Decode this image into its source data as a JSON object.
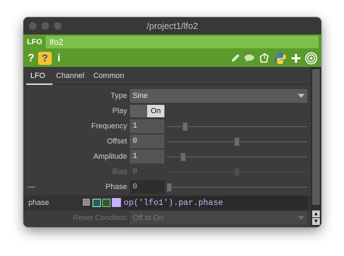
{
  "window": {
    "title": "/project1/lfo2"
  },
  "operator": {
    "type_label": "LFO",
    "name": "lfo2"
  },
  "icon_bar": {
    "help_left": "?",
    "help_python": "?",
    "info": "i",
    "icons": [
      "pencil-icon",
      "comment-icon",
      "clone-icon",
      "python-icon",
      "plus-icon",
      "viewer-icon"
    ]
  },
  "tabs": [
    "LFO",
    "Channel",
    "Common"
  ],
  "params": {
    "type": {
      "label": "Type",
      "value": "Sine"
    },
    "play": {
      "label": "Play",
      "value": "On"
    },
    "frequency": {
      "label": "Frequency",
      "value": "1"
    },
    "offset": {
      "label": "Offset",
      "value": "0"
    },
    "amplitude": {
      "label": "Amplitude",
      "value": "1"
    },
    "bias": {
      "label": "Bias",
      "value": "0"
    },
    "phase": {
      "label": "Phase",
      "value": "0",
      "collapse": "—"
    },
    "reset_condition": {
      "label": "Reset Condition",
      "value": "Off to On"
    }
  },
  "expression": {
    "name": "phase",
    "value": "op('lfo1').par.phase"
  },
  "colors": {
    "operator_green": "#5e9c2e",
    "name_field_green": "#7fbf4c",
    "expression_purple": "#c7b2ff"
  }
}
